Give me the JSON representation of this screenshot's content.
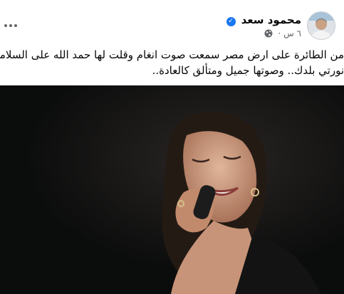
{
  "post": {
    "author_name": "محمود سعد",
    "verified_icon": "verified-badge-icon",
    "time_ago": "٦ س",
    "separator": "·",
    "privacy_icon": "globe-icon",
    "more_icon": "more-options-icon",
    "text_lines": [
      "من الطائرة على ارض مصر سمعت صوت انغام وقلت لها حمد الله على السلامة",
      "نورتي بلدك.. وصوتها جميل ومتألق كالعادة.."
    ],
    "image_icon": "singer-photo"
  },
  "colors": {
    "brand_blue": "#1877f2",
    "text_primary": "#050505",
    "text_secondary": "#65676b",
    "photo_bg": "#0b0c0c"
  }
}
